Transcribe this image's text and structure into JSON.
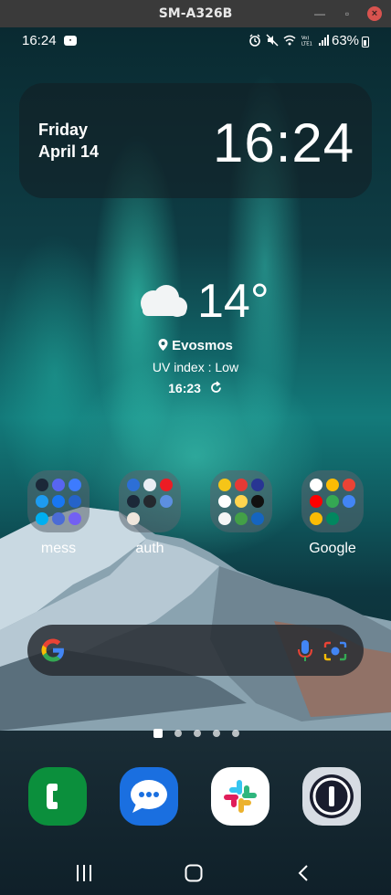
{
  "window": {
    "title": "SM-A326B"
  },
  "status_bar": {
    "time": "16:24",
    "app_notification_icon": "app-badge-icon",
    "battery_percent": "63%",
    "icons": [
      "alarm-icon",
      "mute-icon",
      "wifi-icon",
      "volte-icon",
      "signal-icon",
      "battery-icon"
    ]
  },
  "clock_widget": {
    "day": "Friday",
    "date": "April 14",
    "time": "16:24"
  },
  "weather_widget": {
    "temperature": "14°",
    "location": "Evosmos",
    "uv_index": "UV index : Low",
    "updated": "16:23",
    "icon": "cloudy-icon"
  },
  "folders": [
    {
      "label": "mess",
      "icons": [
        "steam-icon",
        "discord-icon",
        "messenger-icon",
        "twitter-icon",
        "facebook-icon",
        "chat-icon",
        "skype-icon",
        "email-icon",
        "viber-icon"
      ]
    },
    {
      "label": "auth",
      "icons": [
        "shield-icon",
        "lock-icon",
        "authy-icon",
        "steam-icon",
        "github-icon",
        "google-auth-icon",
        "key-icon"
      ]
    },
    {
      "label": "",
      "icons": [
        "yellow-app-icon",
        "red-app-icon",
        "settings-app-icon",
        "paypal-icon",
        "card-icon",
        "black-app-icon",
        "revolut-icon",
        "green-app-icon",
        "blue-app-icon"
      ]
    },
    {
      "label": "Google",
      "icons": [
        "google-icon",
        "chrome-icon",
        "gmail-icon",
        "youtube-icon",
        "maps-icon",
        "drive-icon",
        "keep-icon",
        "play-icon"
      ]
    }
  ],
  "search_bar": {
    "icons": [
      "google-g-icon",
      "microphone-icon",
      "google-lens-icon"
    ]
  },
  "page_indicator": {
    "pages": 5,
    "current": 0
  },
  "dock": [
    {
      "name": "phone",
      "icon": "phone-icon",
      "color": "#0b8f3c"
    },
    {
      "name": "messages",
      "icon": "messages-icon",
      "color": "#1a6fe0"
    },
    {
      "name": "slack",
      "icon": "slack-icon",
      "color": "#ffffff"
    },
    {
      "name": "1password",
      "icon": "1password-icon",
      "color": "#d7dce3"
    }
  ],
  "nav_bar": {
    "buttons": [
      "recents-button",
      "home-button",
      "back-button"
    ]
  }
}
